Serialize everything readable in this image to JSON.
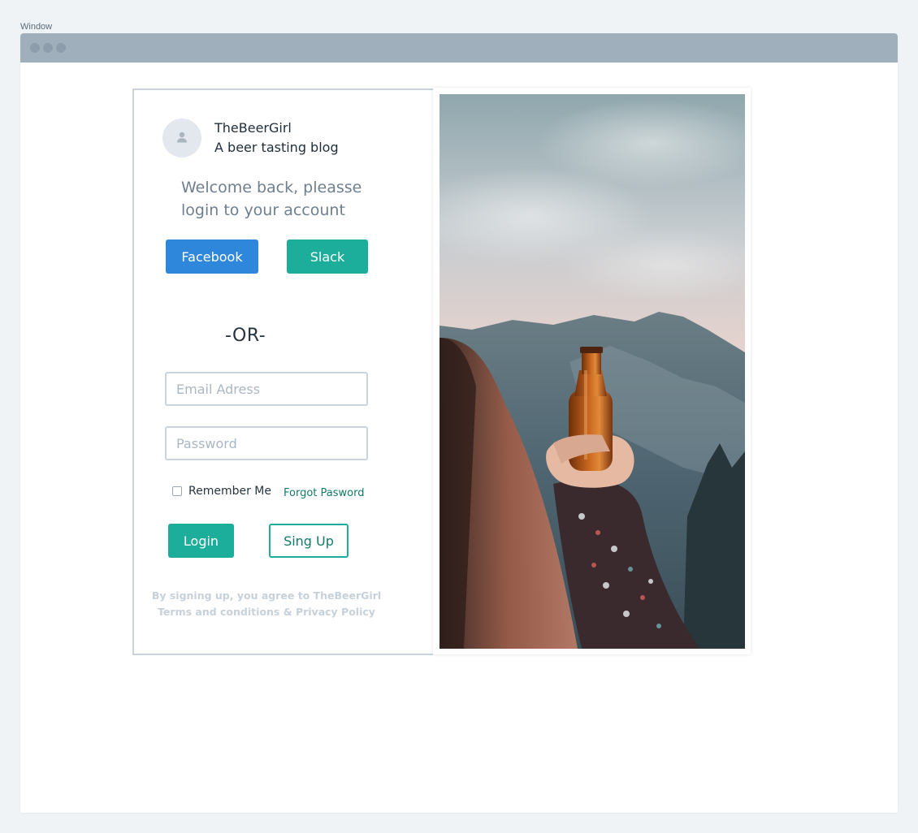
{
  "window": {
    "caption": "Window"
  },
  "brand": {
    "name": "TheBeerGirl",
    "tagline": "A beer tasting blog"
  },
  "login": {
    "welcome": "Welcome back, pleasse login to your account",
    "facebook_label": "Facebook",
    "slack_label": "Slack",
    "or_label": "-OR-",
    "email_placeholder": "Email Adress",
    "password_placeholder": "Password",
    "remember_label": "Remember Me",
    "remember_checked": false,
    "forgot_label": "Forgot Pasword",
    "login_label": "Login",
    "signup_label": "Sing Up",
    "legal_line1": "By signing up, you agree to TheBeerGirl",
    "legal_line2": "Terms and conditions & Privacy Policy"
  },
  "colors": {
    "facebook": "#2f87db",
    "accent": "#1cae9a",
    "link": "#137a68",
    "titlebar": "#9fafbc",
    "page_bg": "#eff3f6"
  },
  "icons": {
    "avatar": "user-icon"
  },
  "photo": {
    "subject": "hand-holding-beer-bottle-mountains"
  }
}
